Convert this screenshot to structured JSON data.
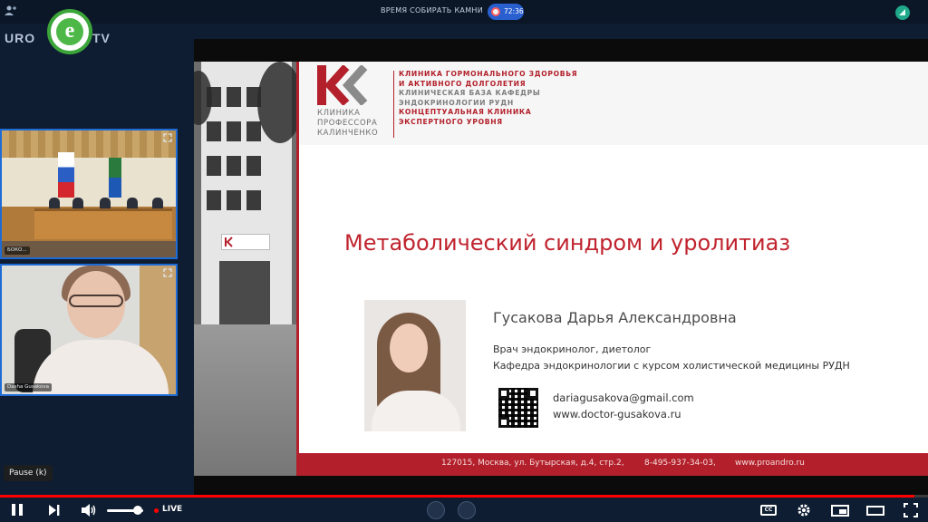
{
  "app": {
    "meeting_title": "ВРЕМЯ СОБИРАТЬ КАМНИ",
    "recording_time": "72:36"
  },
  "logo": {
    "text_left": "URO",
    "badge_letter": "e",
    "text_right": "TV"
  },
  "participants": [
    {
      "name": "БОКО..."
    },
    {
      "name": "Dasha Gusakova"
    }
  ],
  "slide": {
    "brand_name_lines": [
      "КЛИНИКА",
      "ПРОФЕССОРА",
      "КАЛИНЧЕНКО"
    ],
    "brand_lines": [
      "КЛИНИКА ГОРМОНАЛЬНОГО ЗДОРОВЬЯ",
      "И АКТИВНОГО ДОЛГОЛЕТИЯ",
      "КЛИНИЧЕСКАЯ БАЗА КАФЕДРЫ",
      "ЭНДОКРИНОЛОГИИ РУДН",
      "КОНЦЕПТУАЛЬНАЯ КЛИНИКА",
      "ЭКСПЕРТНОГО УРОВНЯ"
    ],
    "title": "Метаболический синдром и уролитиаз",
    "speaker_name": "Гусакова Дарья Александровна",
    "speaker_role": "Врач эндокринолог, диетолог",
    "speaker_dept": "Кафедра эндокринологии с курсом холистической медицины РУДН",
    "email": "dariagusakova@gmail.com",
    "website": "www.doctor-gusakova.ru",
    "footer_address": "127015, Москва, ул. Бутырская, д.4, стр.2,",
    "footer_phone": "8-495-937-34-03,",
    "footer_site": "www.proandro.ru"
  },
  "player": {
    "tooltip": "Pause (k)",
    "live_label": "LIVE",
    "cc_label": "CC",
    "progress_fraction": 0.985,
    "volume_fraction": 0.85
  },
  "colors": {
    "accent_blue": "#1e6bd6",
    "slide_red": "#b3202b",
    "live_red": "#ff0000"
  },
  "icons": {
    "user": "user-icon",
    "record": "record-icon",
    "status": "status-icon",
    "expand": "expand-icon",
    "pause": "pause-icon",
    "next": "next-icon",
    "volume": "volume-icon",
    "cc": "cc-icon",
    "settings": "gear-icon",
    "miniplayer": "miniplayer-icon",
    "theater": "theater-icon",
    "fullscreen": "fullscreen-icon"
  }
}
